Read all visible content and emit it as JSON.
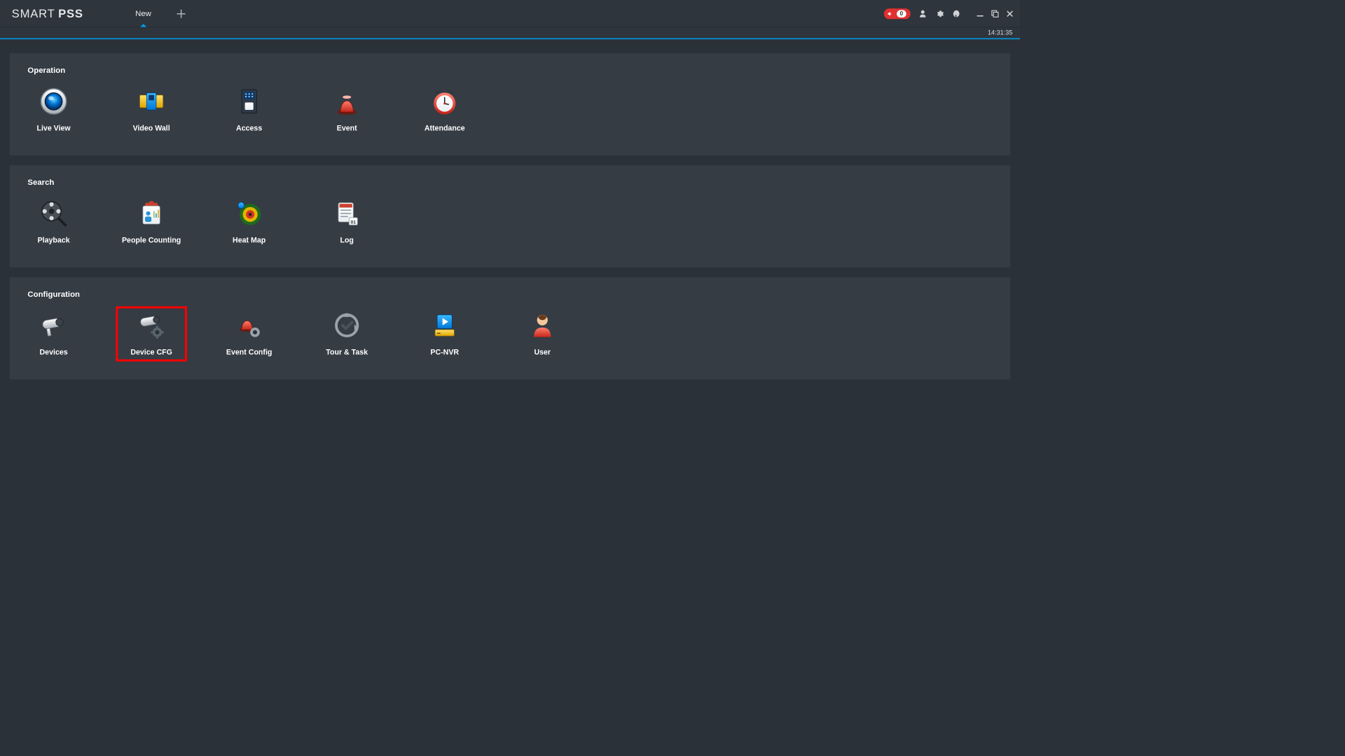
{
  "app": {
    "logo_part1": "SMART",
    "logo_part2": "PSS"
  },
  "tabs": [
    {
      "label": "New",
      "active": true
    }
  ],
  "titlebar": {
    "alarm_count": "0",
    "clock": "14:31:35"
  },
  "sections": {
    "operation": {
      "title": "Operation",
      "items": [
        {
          "id": "live-view",
          "label": "Live View",
          "icon": "liveview-icon"
        },
        {
          "id": "video-wall",
          "label": "Video Wall",
          "icon": "videowall-icon"
        },
        {
          "id": "access",
          "label": "Access",
          "icon": "access-icon"
        },
        {
          "id": "event",
          "label": "Event",
          "icon": "event-icon"
        },
        {
          "id": "attendance",
          "label": "Attendance",
          "icon": "attendance-icon"
        }
      ]
    },
    "search": {
      "title": "Search",
      "items": [
        {
          "id": "playback",
          "label": "Playback",
          "icon": "playback-icon"
        },
        {
          "id": "people-counting",
          "label": "People Counting",
          "icon": "peoplecounting-icon"
        },
        {
          "id": "heat-map",
          "label": "Heat Map",
          "icon": "heatmap-icon"
        },
        {
          "id": "log",
          "label": "Log",
          "icon": "log-icon"
        }
      ]
    },
    "configuration": {
      "title": "Configuration",
      "items": [
        {
          "id": "devices",
          "label": "Devices",
          "icon": "devices-icon"
        },
        {
          "id": "device-cfg",
          "label": "Device CFG",
          "icon": "devicecfg-icon",
          "highlight": true
        },
        {
          "id": "event-config",
          "label": "Event Config",
          "icon": "eventconfig-icon"
        },
        {
          "id": "tour-task",
          "label": "Tour & Task",
          "icon": "tourtask-icon"
        },
        {
          "id": "pc-nvr",
          "label": "PC-NVR",
          "icon": "pcnvr-icon"
        },
        {
          "id": "user",
          "label": "User",
          "icon": "user-icon"
        }
      ]
    }
  }
}
